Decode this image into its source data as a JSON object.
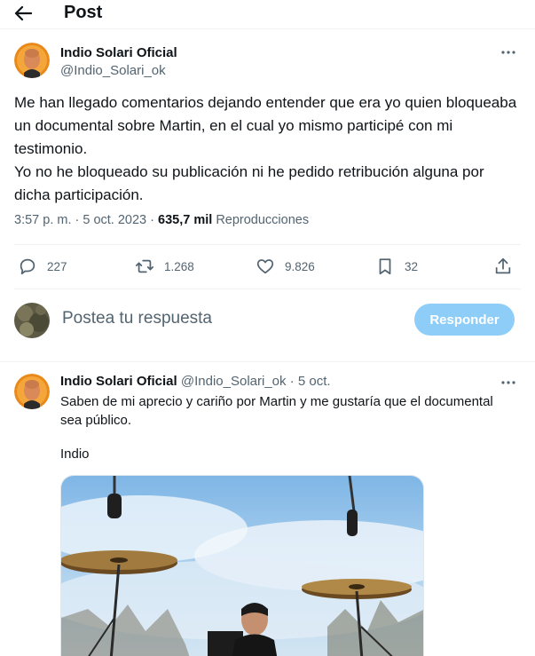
{
  "header": {
    "title": "Post"
  },
  "tweet": {
    "author": {
      "display_name": "Indio Solari Oficial",
      "handle": "@Indio_Solari_ok"
    },
    "text": [
      "Me han llegado comentarios dejando entender que era yo quien bloqueaba un documental sobre Martin, en el cual yo mismo participé con mi testimonio.",
      "Yo no he bloqueado su publicación ni he pedido retribución alguna por dicha participación."
    ],
    "time": "3:57 p. m.",
    "date": "5 oct. 2023",
    "views": "635,7 mil",
    "views_label": "Reproducciones",
    "stats": {
      "replies": "227",
      "reposts": "1.268",
      "likes": "9.826",
      "bookmarks": "32"
    }
  },
  "compose": {
    "placeholder": "Postea tu respuesta",
    "button_label": "Responder"
  },
  "reply": {
    "author": {
      "display_name": "Indio Solari Oficial",
      "handle": "@Indio_Solari_ok",
      "date": "5 oct."
    },
    "text": "Saben de mi aprecio y cariño por Martin y me gustaría que el documental sea público.",
    "signature": "Indio"
  },
  "colors": {
    "text_primary": "#0f1419",
    "text_secondary": "#536471",
    "button_disabled": "#8ecdf8",
    "divider": "#eff3f4"
  },
  "icons": [
    "back-arrow-icon",
    "more-icon",
    "reply-icon",
    "repost-icon",
    "like-icon",
    "bookmark-icon",
    "share-icon"
  ]
}
